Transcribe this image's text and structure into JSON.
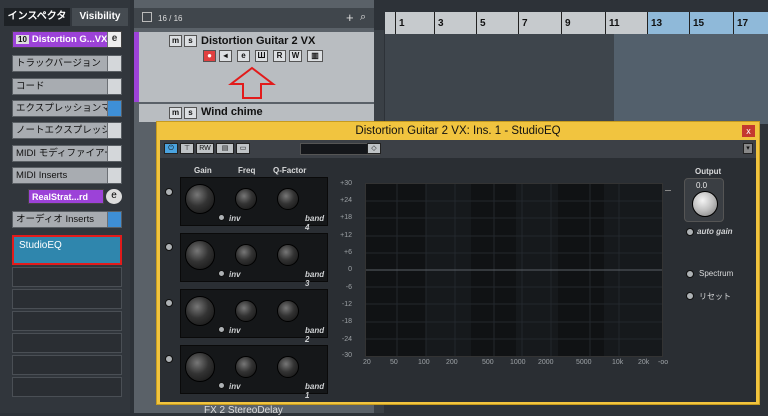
{
  "inspector": {
    "tabs": [
      "インスペクター",
      "Visibility"
    ],
    "track_number": "10",
    "track_name": "Distortion G...VX",
    "rows": [
      "トラックバージョン",
      "コード",
      "エクスプレッションマップ",
      "ノートエクスプレッション",
      "MIDI モディファイアー",
      "MIDI Inserts"
    ],
    "plugin_slot": "RealStrat...rd",
    "audio_inserts": "オーディオ Inserts",
    "insert_slot": "StudioEQ"
  },
  "tracklist": {
    "count": "16 / 16",
    "track1_name": "Distortion Guitar 2 VX",
    "track2_name": "Wind chime",
    "bottom_track": "FX 2 StereoDelay"
  },
  "ruler": {
    "bars": [
      "1",
      "3",
      "5",
      "7",
      "9",
      "11",
      "13",
      "15",
      "17"
    ]
  },
  "plugin": {
    "title": "Distortion Guitar 2 VX: Ins. 1 - StudioEQ",
    "headers": [
      "Gain",
      "Freq",
      "Q-Factor"
    ],
    "bands": [
      "band 4",
      "band 3",
      "band 2",
      "band 1"
    ],
    "inv_label": "inv",
    "output_label": "Output",
    "output_value": "0.0",
    "auto_gain": "auto gain",
    "spectrum": "Spectrum",
    "reset": "リセット",
    "y_labels": [
      "+30",
      "+24",
      "+18",
      "+12",
      "+6",
      "0",
      "-6",
      "-12",
      "-18",
      "-24",
      "-30"
    ],
    "x_labels": [
      "20",
      "50",
      "100",
      "200",
      "500",
      "1000",
      "2000",
      "5000",
      "10k",
      "20k",
      "-oo"
    ]
  },
  "colors": {
    "accent": "#a855e0",
    "highlight": "#e21b1b",
    "plugin_border": "#f1c43f"
  }
}
